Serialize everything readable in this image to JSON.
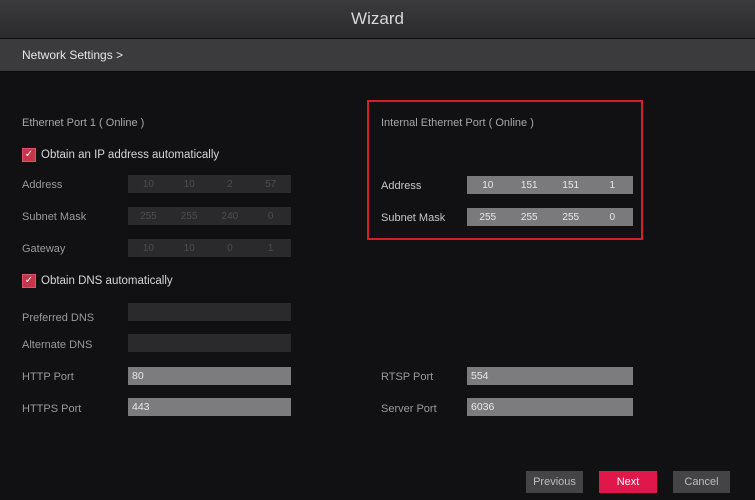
{
  "window": {
    "title": "Wizard"
  },
  "breadcrumb": "Network Settings >",
  "ethernet1": {
    "title": "Ethernet Port 1 ( Online )",
    "obtain_ip_label": "Obtain an IP address automatically",
    "obtain_ip_checked": true,
    "address_label": "Address",
    "address": [
      "10",
      "10",
      "2",
      "57"
    ],
    "subnet_label": "Subnet Mask",
    "subnet": [
      "255",
      "255",
      "240",
      "0"
    ],
    "gateway_label": "Gateway",
    "gateway": [
      "10",
      "10",
      "0",
      "1"
    ],
    "obtain_dns_label": "Obtain DNS automatically",
    "obtain_dns_checked": true,
    "preferred_dns_label": "Preferred DNS",
    "alternate_dns_label": "Alternate DNS"
  },
  "internal": {
    "title": "Internal Ethernet Port ( Online )",
    "address_label": "Address",
    "address": [
      "10",
      "151",
      "151",
      "1"
    ],
    "subnet_label": "Subnet Mask",
    "subnet": [
      "255",
      "255",
      "255",
      "0"
    ]
  },
  "ports": {
    "http_label": "HTTP Port",
    "http": "80",
    "https_label": "HTTPS Port",
    "https": "443",
    "rtsp_label": "RTSP Port",
    "rtsp": "554",
    "server_label": "Server Port",
    "server": "6036"
  },
  "buttons": {
    "previous": "Previous",
    "next": "Next",
    "cancel": "Cancel"
  },
  "colors": {
    "accent": "#e0174a",
    "highlight_border": "#d21f2a"
  }
}
